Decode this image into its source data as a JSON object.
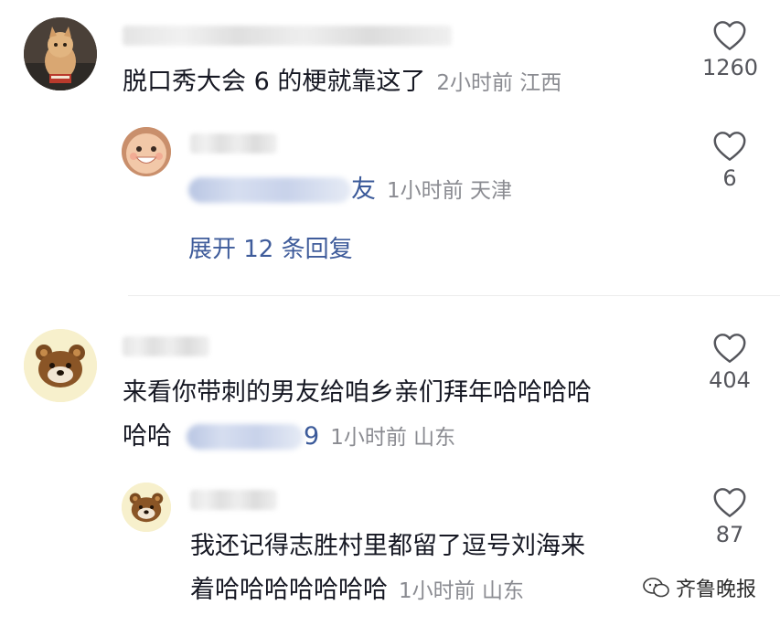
{
  "comments": [
    {
      "text": "脱口秀大会 6 的梗就靠这了",
      "meta": "2小时前 江西",
      "likes": "1260",
      "reply": {
        "mention_tail": "友",
        "meta": "1小时前 天津",
        "likes": "6",
        "expand_label": "展开 12 条回复"
      }
    },
    {
      "text_line1": "来看你带刺的男友给咱乡亲们拜年哈哈哈哈",
      "text_line2": "哈哈",
      "mention_tail": "9",
      "meta": "1小时前 山东",
      "likes": "404",
      "reply": {
        "text_line1": "我还记得志胜村里都留了逗号刘海来",
        "text_line2": "着哈哈哈哈哈哈哈",
        "meta": "1小时前 山东",
        "likes": "87"
      }
    }
  ],
  "watermark": "齐鲁晚报",
  "colors": {
    "link": "#3f5c9b",
    "meta": "#8a8b91",
    "text": "#161823"
  }
}
